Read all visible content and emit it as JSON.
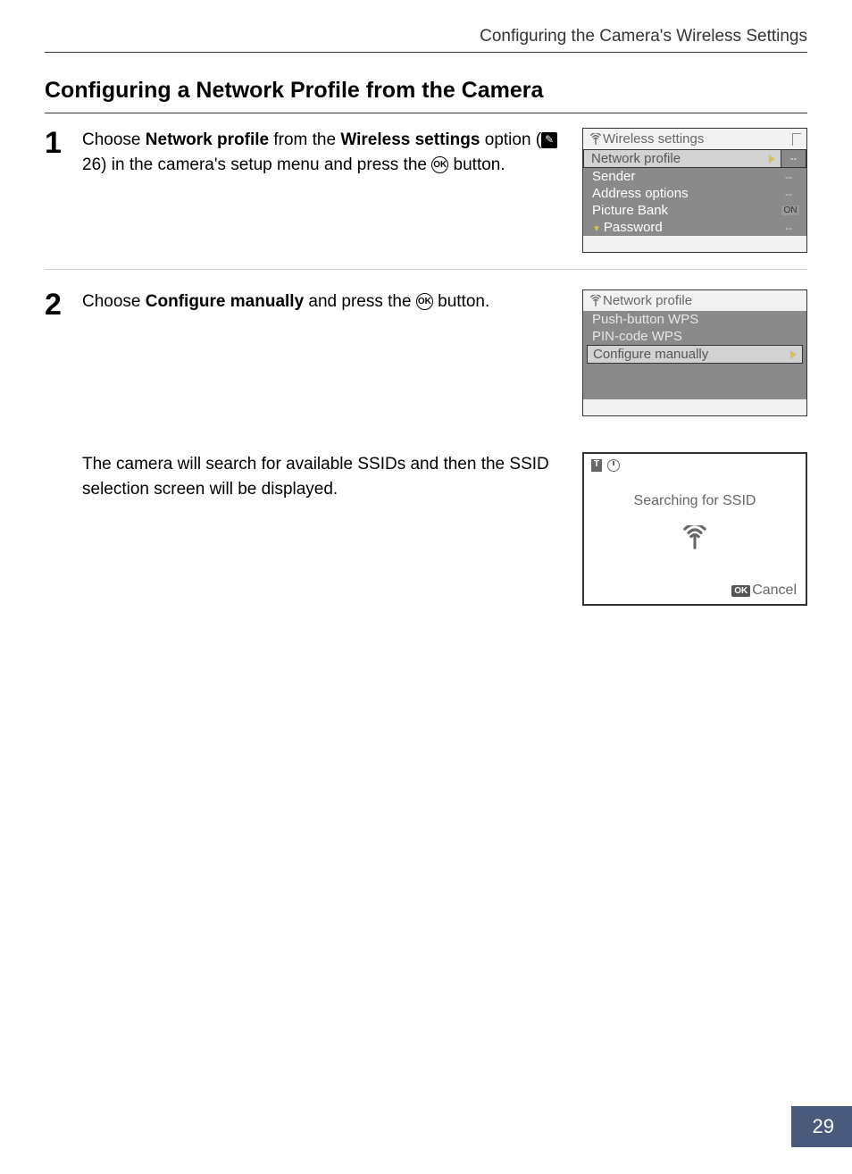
{
  "header": "Configuring the Camera's Wireless Settings",
  "section_title": "Configuring a Network Profile from the Camera",
  "page_number": "29",
  "step1": {
    "num": "1",
    "text_1": "Choose ",
    "bold_1": "Network profile",
    "text_2": " from the ",
    "bold_2": "Wireless settings",
    "text_3": " option (",
    "ref": "26",
    "text_4": ") in the camera's setup menu and press the ",
    "text_5": " button."
  },
  "screen1": {
    "title": "Wireless settings",
    "rows": [
      {
        "label": "Network profile",
        "value": "--",
        "selected": true
      },
      {
        "label": "Sender",
        "value": "--"
      },
      {
        "label": "Address options",
        "value": "--"
      },
      {
        "label": "Picture Bank",
        "value": "ON"
      },
      {
        "label": "Password",
        "value": "--"
      }
    ]
  },
  "step2": {
    "num": "2",
    "text_1": "Choose ",
    "bold_1": "Configure manually",
    "text_2": " and press the ",
    "text_3": " button."
  },
  "screen2": {
    "title": "Network profile",
    "rows": [
      {
        "label": "Push-button WPS"
      },
      {
        "label": "PIN-code WPS"
      },
      {
        "label": "Configure manually",
        "selected": true
      }
    ]
  },
  "substep_text": "The camera will search for available SSIDs and then the SSID selection screen will be displayed.",
  "screen3": {
    "message": "Searching for SSID",
    "cancel": "Cancel",
    "ok": "OK"
  }
}
